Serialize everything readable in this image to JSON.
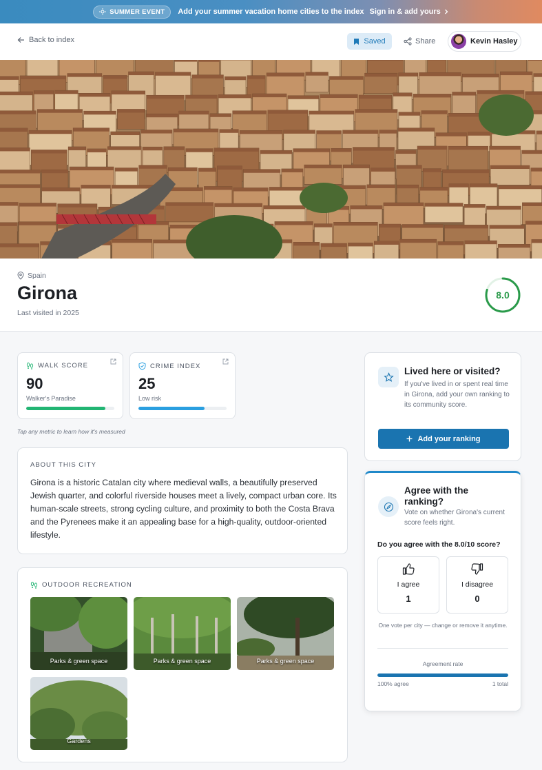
{
  "banner": {
    "pill": "SUMMER EVENT",
    "text": "Add your summer vacation home cities to the index",
    "link": "Sign in & add yours"
  },
  "nav": {
    "back": "Back to index",
    "saved": "Saved",
    "share": "Share",
    "user": "Kevin Hasley"
  },
  "city": {
    "country": "Spain",
    "name": "Girona",
    "last_visited": "Last visited in 2025",
    "score": "8.0",
    "score_fraction": 0.8
  },
  "metrics": {
    "walk": {
      "label": "WALK SCORE",
      "value": "90",
      "sub": "Walker's Paradise",
      "level": 0.9,
      "color": "#22b573"
    },
    "crime": {
      "label": "CRIME INDEX",
      "value": "25",
      "sub": "Low risk",
      "level": 0.75,
      "color": "#2a9fe0"
    },
    "hint": "Tap any metric to learn how it's measured"
  },
  "about": {
    "label": "ABOUT THIS CITY",
    "text": "Girona is a historic Catalan city where medieval walls, a beautifully preserved Jewish quarter, and colorful riverside houses meet a lively, compact urban core. Its human-scale streets, strong cycling culture, and proximity to both the Costa Brava and the Pyrenees make it an appealing base for a high-quality, outdoor-oriented lifestyle."
  },
  "outdoor": {
    "label": "OUTDOOR RECREATION",
    "photos": [
      {
        "caption": "Parks & green space"
      },
      {
        "caption": "Parks & green space"
      },
      {
        "caption": "Parks & green space"
      },
      {
        "caption": "Gardens"
      }
    ]
  },
  "lived": {
    "title": "Lived here or visited?",
    "desc": "If you've lived in or spent real time in Girona, add your own ranking to its community score.",
    "button": "Add your ranking"
  },
  "agree": {
    "title": "Agree with the ranking?",
    "desc": "Vote on whether Girona's current score feels right.",
    "question": "Do you agree with the 8.0/10 score?",
    "agree_label": "I agree",
    "agree_count": "1",
    "disagree_label": "I disagree",
    "disagree_count": "0",
    "note": "One vote per city — change or remove it anytime.",
    "rate_label": "Agreement rate",
    "rate_left": "100% agree",
    "rate_right": "1 total",
    "rate_level": 1.0
  },
  "colors": {
    "accent": "#1a74b0",
    "score_green": "#2a9a4a"
  }
}
